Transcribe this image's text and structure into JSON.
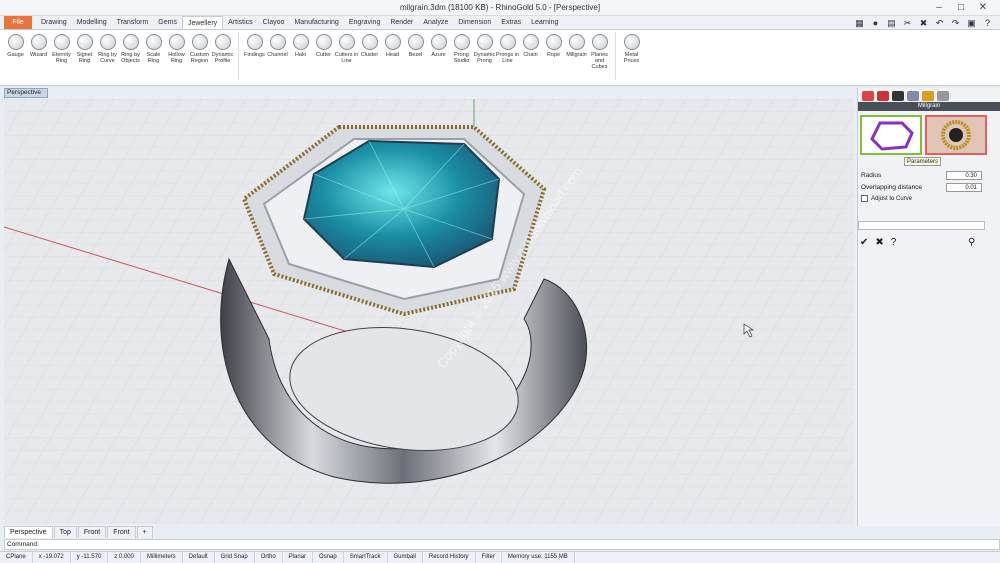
{
  "window": {
    "title": "milgrain.3dm (18100 KB) - RhinoGold 5.0 - [Perspective]"
  },
  "tabs": [
    "File",
    "Drawing",
    "Modelling",
    "Transform",
    "Gems",
    "Jewellery",
    "Artistics",
    "Clayoo",
    "Manufacturing",
    "Engraving",
    "Render",
    "Analyze",
    "Dimension",
    "Extras",
    "Learning"
  ],
  "active_tab": "Jewellery",
  "tools": [
    "Gauge",
    "Wizard",
    "Eternity Ring",
    "Signet Ring",
    "Ring by Curve",
    "Ring by Objects",
    "Scale Ring",
    "Hollow Ring",
    "Custom Region",
    "Dynamic Profile",
    "Findings",
    "Channel",
    "Halo",
    "Cutter",
    "Cutters in Line",
    "Cluster",
    "Head",
    "Bezel",
    "Azure",
    "Prong Studio",
    "Dynamic Prong",
    "Prongs in Line",
    "Chain",
    "Rope",
    "Millgrain",
    "Planes and Cubes",
    "Metal Prices"
  ],
  "viewport": {
    "name": "Perspective",
    "watermark": "Copyright © 2015 www.p30download.com"
  },
  "panel": {
    "title": "Millgrain",
    "tooltip": "Parameters",
    "radius_label": "Radius",
    "radius_value": "0.30",
    "overlap_label": "Overlapping distance",
    "overlap_value": "0.01",
    "adjust_label": "Adjust to Curve"
  },
  "view_tabs": [
    "Perspective",
    "Top",
    "Front",
    "Front",
    "+"
  ],
  "command": {
    "label": "Command:"
  },
  "status": [
    "CPlane",
    "x -19.072",
    "y -11.570",
    "z 0.000",
    "Millimeters",
    "Default",
    "Grid Snap",
    "Ortho",
    "Planar",
    "Osnap",
    "SmartTrack",
    "Gumball",
    "Record History",
    "Filter",
    "Memory use: 1155 MB"
  ],
  "colors": {
    "file_tab": "#e8743b",
    "accent": "#7fbf3a"
  }
}
